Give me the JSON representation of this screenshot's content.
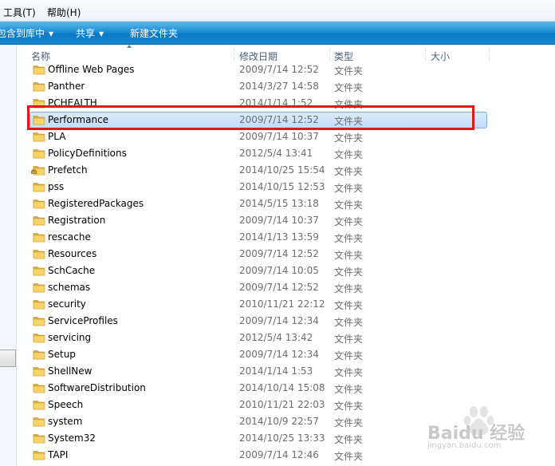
{
  "menubar": {
    "items": [
      "工具(T)",
      "帮助(H)"
    ]
  },
  "toolbar": {
    "include_library": "包含到库中",
    "share": "共享",
    "new_folder": "新建文件夹"
  },
  "columns": {
    "name": "名称",
    "date": "修改日期",
    "type": "类型",
    "size": "大小"
  },
  "rows": [
    {
      "name": "Offline Web Pages",
      "date": "2009/7/14 12:52",
      "type": "文件夹"
    },
    {
      "name": "Panther",
      "date": "2014/3/27 14:58",
      "type": "文件夹"
    },
    {
      "name": "PCHEALTH",
      "date": "2014/1/14 1:52",
      "type": "文件夹"
    },
    {
      "name": "Performance",
      "date": "2009/7/14 12:52",
      "type": "文件夹",
      "selected": true
    },
    {
      "name": "PLA",
      "date": "2009/7/14 10:37",
      "type": "文件夹"
    },
    {
      "name": "PolicyDefinitions",
      "date": "2012/5/4 13:41",
      "type": "文件夹"
    },
    {
      "name": "Prefetch",
      "date": "2014/10/25 15:54",
      "type": "文件夹",
      "locked": true
    },
    {
      "name": "pss",
      "date": "2014/10/15 12:53",
      "type": "文件夹"
    },
    {
      "name": "RegisteredPackages",
      "date": "2014/5/15 13:18",
      "type": "文件夹"
    },
    {
      "name": "Registration",
      "date": "2009/7/14 10:37",
      "type": "文件夹"
    },
    {
      "name": "rescache",
      "date": "2014/1/13 13:59",
      "type": "文件夹"
    },
    {
      "name": "Resources",
      "date": "2009/7/14 12:52",
      "type": "文件夹"
    },
    {
      "name": "SchCache",
      "date": "2009/7/14 10:05",
      "type": "文件夹"
    },
    {
      "name": "schemas",
      "date": "2009/7/14 12:52",
      "type": "文件夹"
    },
    {
      "name": "security",
      "date": "2010/11/21 22:12",
      "type": "文件夹"
    },
    {
      "name": "ServiceProfiles",
      "date": "2009/7/14 12:34",
      "type": "文件夹"
    },
    {
      "name": "servicing",
      "date": "2012/5/4 13:42",
      "type": "文件夹"
    },
    {
      "name": "Setup",
      "date": "2009/7/14 12:34",
      "type": "文件夹"
    },
    {
      "name": "ShellNew",
      "date": "2014/1/14 1:53",
      "type": "文件夹"
    },
    {
      "name": "SoftwareDistribution",
      "date": "2014/10/14 15:08",
      "type": "文件夹"
    },
    {
      "name": "Speech",
      "date": "2010/11/21 22:03",
      "type": "文件夹"
    },
    {
      "name": "system",
      "date": "2014/10/9 22:57",
      "type": "文件夹"
    },
    {
      "name": "System32",
      "date": "2014/10/25 13:33",
      "type": "文件夹"
    },
    {
      "name": "TAPI",
      "date": "2009/7/14 12:46",
      "type": "文件夹"
    }
  ],
  "watermark": {
    "text": "Baidu 经验",
    "url": "jingyan.baidu.com"
  },
  "colors": {
    "toolbar": "#1d8fd7",
    "selection": "#c1dcfc",
    "highlight_box": "#e4161b",
    "folder": "#f2c94c"
  }
}
